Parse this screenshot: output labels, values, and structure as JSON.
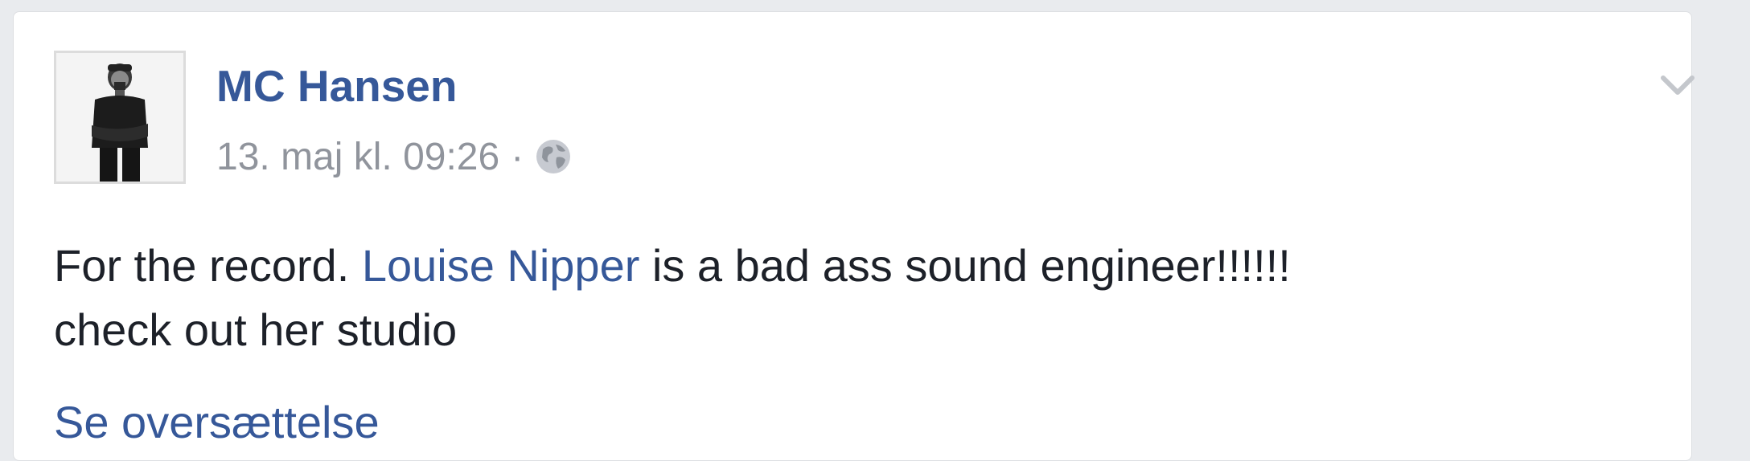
{
  "post": {
    "author": "MC Hansen",
    "timestamp": "13. maj kl. 09:26",
    "separator": "·",
    "privacy_icon": "globe-icon",
    "menu_icon": "chevron-down-icon",
    "text_before_mention": "For the record. ",
    "mention": "Louise Nipper",
    "text_after_mention": " is a bad ass sound engineer!!!!!!",
    "text_line2": "check out her studio",
    "translate_link": "Se oversættelse"
  },
  "colors": {
    "link": "#365899",
    "meta": "#90949c",
    "text": "#1d2129",
    "background": "#e9ebee"
  }
}
